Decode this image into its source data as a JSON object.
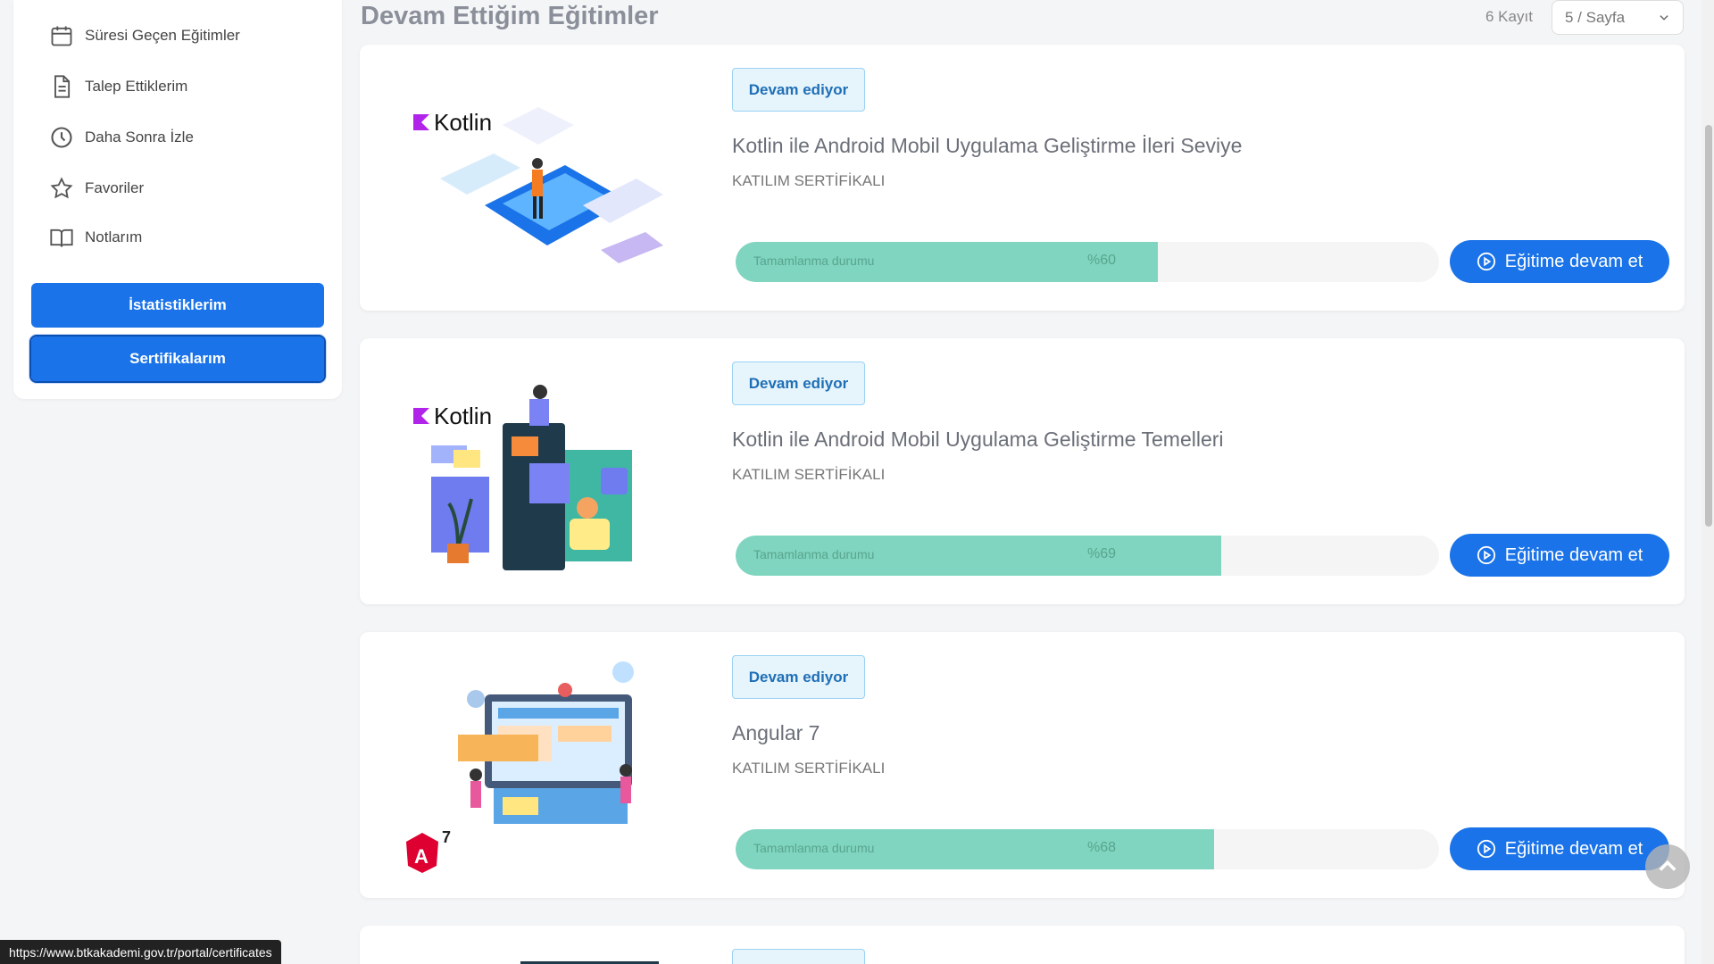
{
  "sidebar": {
    "items": [
      {
        "label": "Süresi Geçen Eğitimler",
        "icon": "calendar-icon"
      },
      {
        "label": "Talep Ettiklerim",
        "icon": "document-icon"
      },
      {
        "label": "Daha Sonra İzle",
        "icon": "clock-icon"
      },
      {
        "label": "Favoriler",
        "icon": "star-icon"
      },
      {
        "label": "Notlarım",
        "icon": "book-icon"
      }
    ],
    "buttons": {
      "statistics": "İstatistiklerim",
      "certificates": "Sertifikalarım"
    }
  },
  "header": {
    "title": "Devam Ettiğim Eğitimler",
    "record_count": "6 Kayıt",
    "per_page": "5 / Sayfa"
  },
  "courses": [
    {
      "status": "Devam ediyor",
      "title": "Kotlin ile Android Mobil Uygulama Geliştirme İleri Seviye",
      "subtitle": "KATILIM SERTİFİKALI",
      "progress_label": "Tamamlanma durumu",
      "progress_text": "%60",
      "progress": 0.6,
      "button": "Eğitime devam et",
      "brand": "Kotlin"
    },
    {
      "status": "Devam ediyor",
      "title": "Kotlin ile Android Mobil Uygulama Geliştirme Temelleri",
      "subtitle": "KATILIM SERTİFİKALI",
      "progress_label": "Tamamlanma durumu",
      "progress_text": "%69",
      "progress": 0.69,
      "button": "Eğitime devam et",
      "brand": "Kotlin"
    },
    {
      "status": "Devam ediyor",
      "title": "Angular 7",
      "subtitle": "KATILIM SERTİFİKALI",
      "progress_label": "Tamamlanma durumu",
      "progress_text": "%68",
      "progress": 0.68,
      "button": "Eğitime devam et",
      "brand": "7"
    }
  ],
  "status_bar": {
    "url": "https://www.btkakademi.gov.tr/portal/certificates"
  },
  "colors": {
    "accent": "#1a73e8",
    "progress": "#7fd5bf",
    "badge_bg": "#e6f4fc"
  }
}
